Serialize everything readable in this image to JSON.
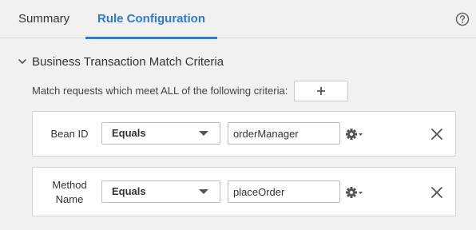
{
  "tabs": [
    {
      "label": "Summary",
      "active": false
    },
    {
      "label": "Rule Configuration",
      "active": true
    }
  ],
  "help_icon": "question-circle-icon",
  "section": {
    "title": "Business Transaction Match Criteria",
    "expanded": true,
    "match_text": "Match requests which meet ALL of the following criteria:",
    "add_label": "+"
  },
  "criteria": [
    {
      "label": "Bean ID",
      "operator": "Equals",
      "value": "orderManager"
    },
    {
      "label_line1": "Method",
      "label_line2": "Name",
      "operator": "Equals",
      "value": "placeOrder"
    }
  ],
  "colors": {
    "accent": "#2c7bd6",
    "background": "#f1f1f1",
    "card": "#ffffff"
  }
}
